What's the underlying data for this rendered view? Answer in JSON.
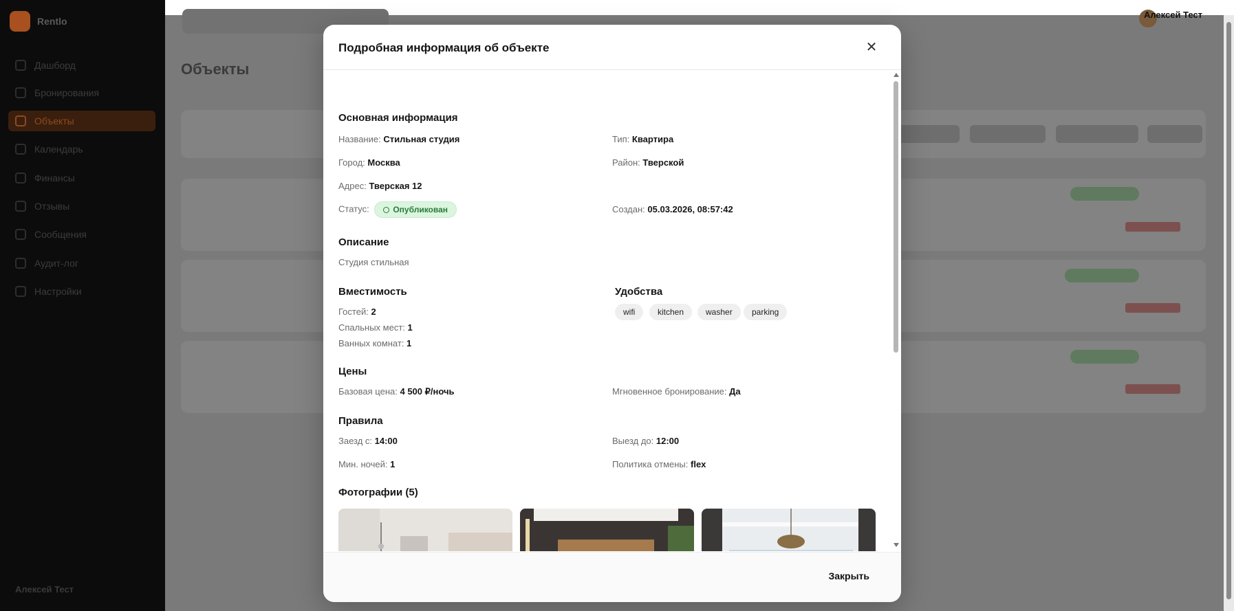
{
  "app": {
    "logo_text": "Rentlo",
    "nav": [
      "Дашборд",
      "Бронирования",
      "Объекты",
      "Календарь",
      "Финансы",
      "Отзывы",
      "Сообщения",
      "Аудит-лог",
      "Настройки"
    ],
    "active_nav": "Объекты",
    "user_name": "Алексей Тест",
    "page_title": "Объекты"
  },
  "modal": {
    "title": "Подробная информация об объекте",
    "close_icon": "close-icon",
    "footer_close": "Закрыть",
    "basic": {
      "heading": "Основная информация",
      "name_label": "Название:",
      "name_value": "Стильная студия",
      "type_label": "Тип:",
      "type_value": "Квартира",
      "city_label": "Город:",
      "city_value": "Москва",
      "district_label": "Район:",
      "district_value": "Тверской",
      "address_label": "Адрес:",
      "address_value": "Тверская 12",
      "status_label": "Статус:",
      "status_value": "Опубликован",
      "created_label": "Создан:",
      "created_value": "05.03.2026, 08:57:42"
    },
    "description": {
      "heading": "Описание",
      "text": "Студия стильная"
    },
    "capacity": {
      "heading": "Вместимость",
      "guests_label": "Гостей:",
      "guests_value": "2",
      "beds_label": "Спальных мест:",
      "beds_value": "1",
      "baths_label": "Ванных комнат:",
      "baths_value": "1"
    },
    "amenities": {
      "heading": "Удобства",
      "items": [
        "wifi",
        "kitchen",
        "washer",
        "parking"
      ]
    },
    "prices": {
      "heading": "Цены",
      "base_label": "Базовая цена:",
      "base_value": "4 500 ₽/ночь",
      "instant_label": "Мгновенное бронирование:",
      "instant_value": "Да"
    },
    "rules": {
      "heading": "Правила",
      "checkin_label": "Заезд с:",
      "checkin_value": "14:00",
      "checkout_label": "Выезд до:",
      "checkout_value": "12:00",
      "min_nights_label": "Мин. ночей:",
      "min_nights_value": "1",
      "cancel_label": "Политика отмены:",
      "cancel_value": "flex"
    },
    "photos": {
      "heading": "Фотографии (5)"
    }
  },
  "colors": {
    "accent": "#f26b1d",
    "status_bg": "#dcf5df",
    "status_fg": "#2a7a3a"
  }
}
